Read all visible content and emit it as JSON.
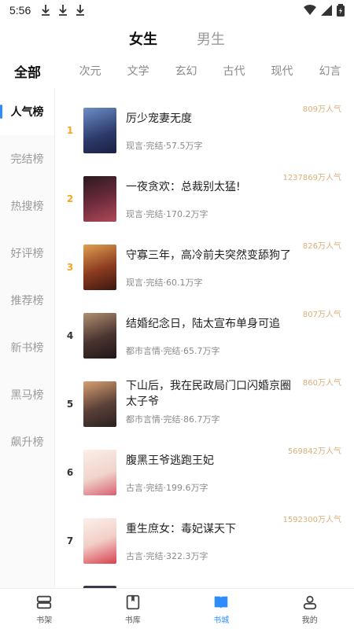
{
  "status": {
    "time": "5:56",
    "icons": [
      "download-icon",
      "download-icon",
      "download-icon",
      "wifi-icon",
      "signal-icon",
      "battery-icon"
    ]
  },
  "gender_tabs": [
    {
      "label": "女生",
      "active": true
    },
    {
      "label": "男生",
      "active": false
    }
  ],
  "category_tabs": [
    {
      "label": "全部",
      "active": true
    },
    {
      "label": "次元"
    },
    {
      "label": "文学"
    },
    {
      "label": "玄幻"
    },
    {
      "label": "古代"
    },
    {
      "label": "现代"
    },
    {
      "label": "幻言"
    }
  ],
  "sidebar": [
    {
      "label": "人气榜",
      "active": true
    },
    {
      "label": "完结榜"
    },
    {
      "label": "热搜榜"
    },
    {
      "label": "好评榜"
    },
    {
      "label": "推荐榜"
    },
    {
      "label": "新书榜"
    },
    {
      "label": "黑马榜"
    },
    {
      "label": "飙升榜"
    }
  ],
  "books": [
    {
      "rank": "1",
      "title": "厉少宠妻无度",
      "meta": "现言·完结·57.5万字",
      "popularity": "809万人气",
      "cover_color": "#3a4a7a",
      "cover_accent": "#7fb0e0"
    },
    {
      "rank": "2",
      "title": "一夜贪欢：总裁别太猛!",
      "meta": "现言·完结·170.2万字",
      "popularity": "1237869万人气",
      "cover_color": "#4b2030",
      "cover_accent": "#c25060"
    },
    {
      "rank": "3",
      "title": "守寡三年，高冷前夫突然变舔狗了",
      "meta": "现言·完结·60.1万字",
      "popularity": "826万人气",
      "cover_color": "#6a2a1e",
      "cover_accent": "#e0a040"
    },
    {
      "rank": "4",
      "title": "结婚纪念日，陆太宣布单身可追",
      "meta": "都市言情·完结·65.7万字",
      "popularity": "807万人气",
      "cover_color": "#3a2a2a",
      "cover_accent": "#b09070"
    },
    {
      "rank": "5",
      "title": "下山后，我在民政局门口闪婚京圈太子爷",
      "meta": "都市言情·完结·86.7万字",
      "popularity": "860万人气",
      "cover_color": "#4a3830",
      "cover_accent": "#d09060"
    },
    {
      "rank": "6",
      "title": "腹黑王爷逃跑王妃",
      "meta": "古言·完结·199.6万字",
      "popularity": "569842万人气",
      "cover_color": "#f0e6e0",
      "cover_accent": "#c0303a"
    },
    {
      "rank": "7",
      "title": "重生庶女：毒妃谋天下",
      "meta": "古言·完结·322.3万字",
      "popularity": "1592300万人气",
      "cover_color": "#f3e8e0",
      "cover_accent": "#d04050"
    }
  ],
  "bottom_nav": [
    {
      "label": "书架",
      "icon": "bookshelf-icon",
      "active": false
    },
    {
      "label": "书库",
      "icon": "library-icon",
      "active": false
    },
    {
      "label": "书城",
      "icon": "bookstore-icon",
      "active": true
    },
    {
      "label": "我的",
      "icon": "profile-icon",
      "active": false
    }
  ],
  "colors": {
    "accent": "#2f8cff",
    "rank_top": "#f5a623",
    "popularity": "#d9b079"
  }
}
